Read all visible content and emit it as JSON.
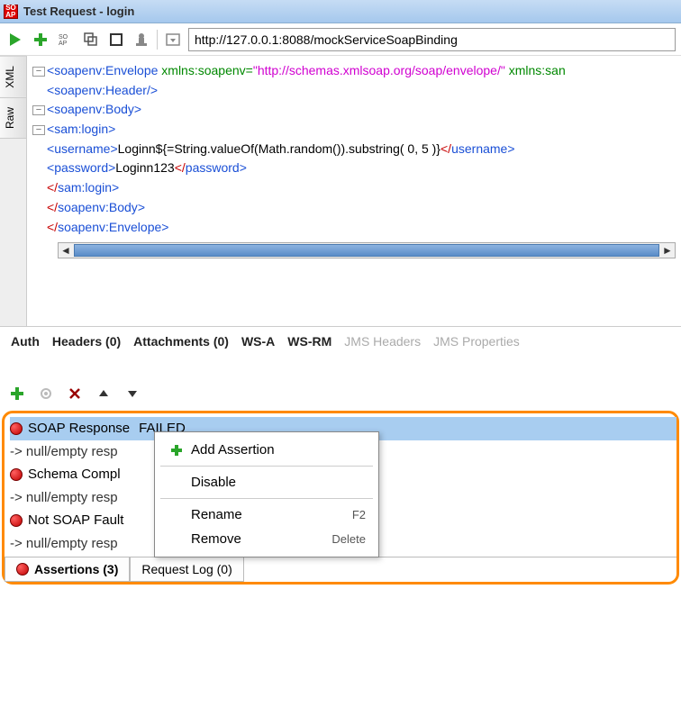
{
  "title": "Test Request - login",
  "url": "http://127.0.0.1:8088/mockServiceSoapBinding",
  "side_tabs": {
    "xml": "XML",
    "raw": "Raw"
  },
  "xml": {
    "l1a": "<",
    "l1b": "soapenv:Envelope",
    "l1c": " xmlns:soapenv=",
    "l1d": "\"http://schemas.xmlsoap.org/soap/envelope/\"",
    "l1e": " xmlns:san",
    "l2a": "<",
    "l2b": "soapenv:Header",
    "l2c": "/>",
    "l3a": "<",
    "l3b": "soapenv:Body",
    "l3c": ">",
    "l4a": "<",
    "l4b": "sam:login",
    "l4c": ">",
    "l5a": "<",
    "l5b": "username",
    "l5c": ">",
    "l5d": "Loginn${=String.valueOf(Math.random()).substring( 0, 5 )}",
    "l5e": "</",
    "l5f": "username",
    "l5g": ">",
    "l6a": "<",
    "l6b": "password",
    "l6c": ">",
    "l6d": "Loginn123",
    "l6e": "</",
    "l6f": "password",
    "l6g": ">",
    "l7a": "</",
    "l7b": "sam:login",
    "l7c": ">",
    "l8a": "</",
    "l8b": "soapenv:Body",
    "l8c": ">",
    "l9a": "</",
    "l9b": "soapenv:Envelope",
    "l9c": ">"
  },
  "bottom_tabs": {
    "auth": "Auth",
    "headers": "Headers (0)",
    "attachments": "Attachments (0)",
    "wsa": "WS-A",
    "wsrm": "WS-RM",
    "jms_headers": "JMS Headers",
    "jms_props": "JMS Properties"
  },
  "assertions": {
    "row1": "SOAP Response",
    "row1_status": "FAILED",
    "detail": "-> null/empty resp",
    "row2": "Schema Compl",
    "row3": "Not SOAP Fault"
  },
  "context_menu": {
    "add": "Add Assertion",
    "disable": "Disable",
    "rename": "Rename",
    "rename_key": "F2",
    "remove": "Remove",
    "remove_key": "Delete"
  },
  "footer": {
    "assertions": "Assertions (3)",
    "request_log": "Request Log (0)"
  }
}
